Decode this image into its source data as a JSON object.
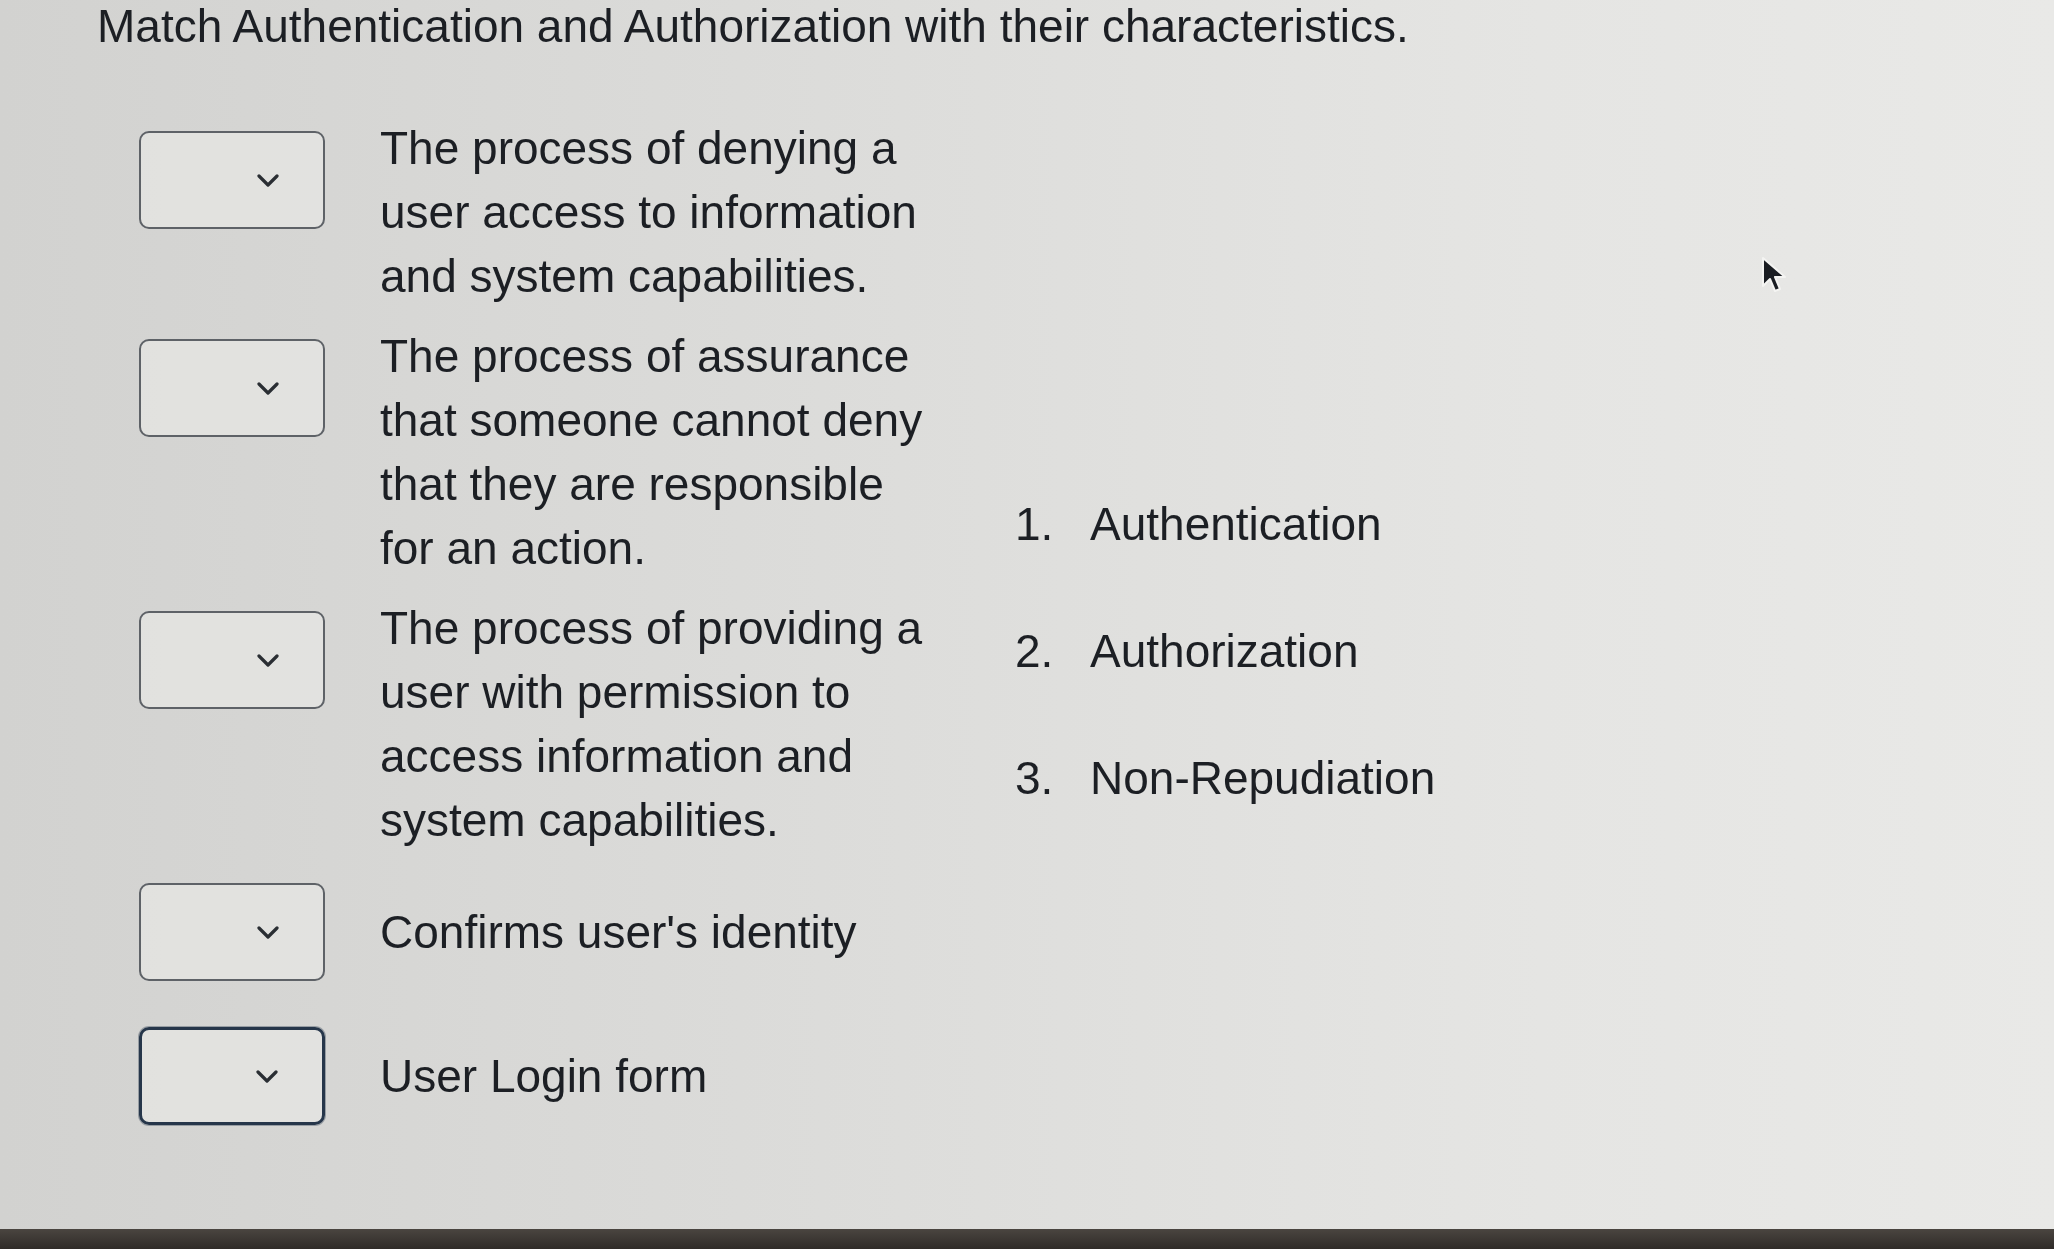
{
  "question": {
    "prompt": "Match Authentication and Authorization with their characteristics."
  },
  "matches": [
    {
      "description": "The process of denying a user access to information and system capabilities.",
      "focused": false
    },
    {
      "description": "The process of assurance that someone cannot deny that they are responsible for an action.",
      "focused": false
    },
    {
      "description": "The process of providing a user with permission to access information and system capabilities.",
      "focused": false
    },
    {
      "description": "Confirms user's identity",
      "focused": false
    },
    {
      "description": "User Login form",
      "focused": true
    }
  ],
  "options": [
    {
      "number": "1.",
      "label": "Authentication"
    },
    {
      "number": "2.",
      "label": "Authorization"
    },
    {
      "number": "3.",
      "label": "Non-Repudiation"
    }
  ]
}
